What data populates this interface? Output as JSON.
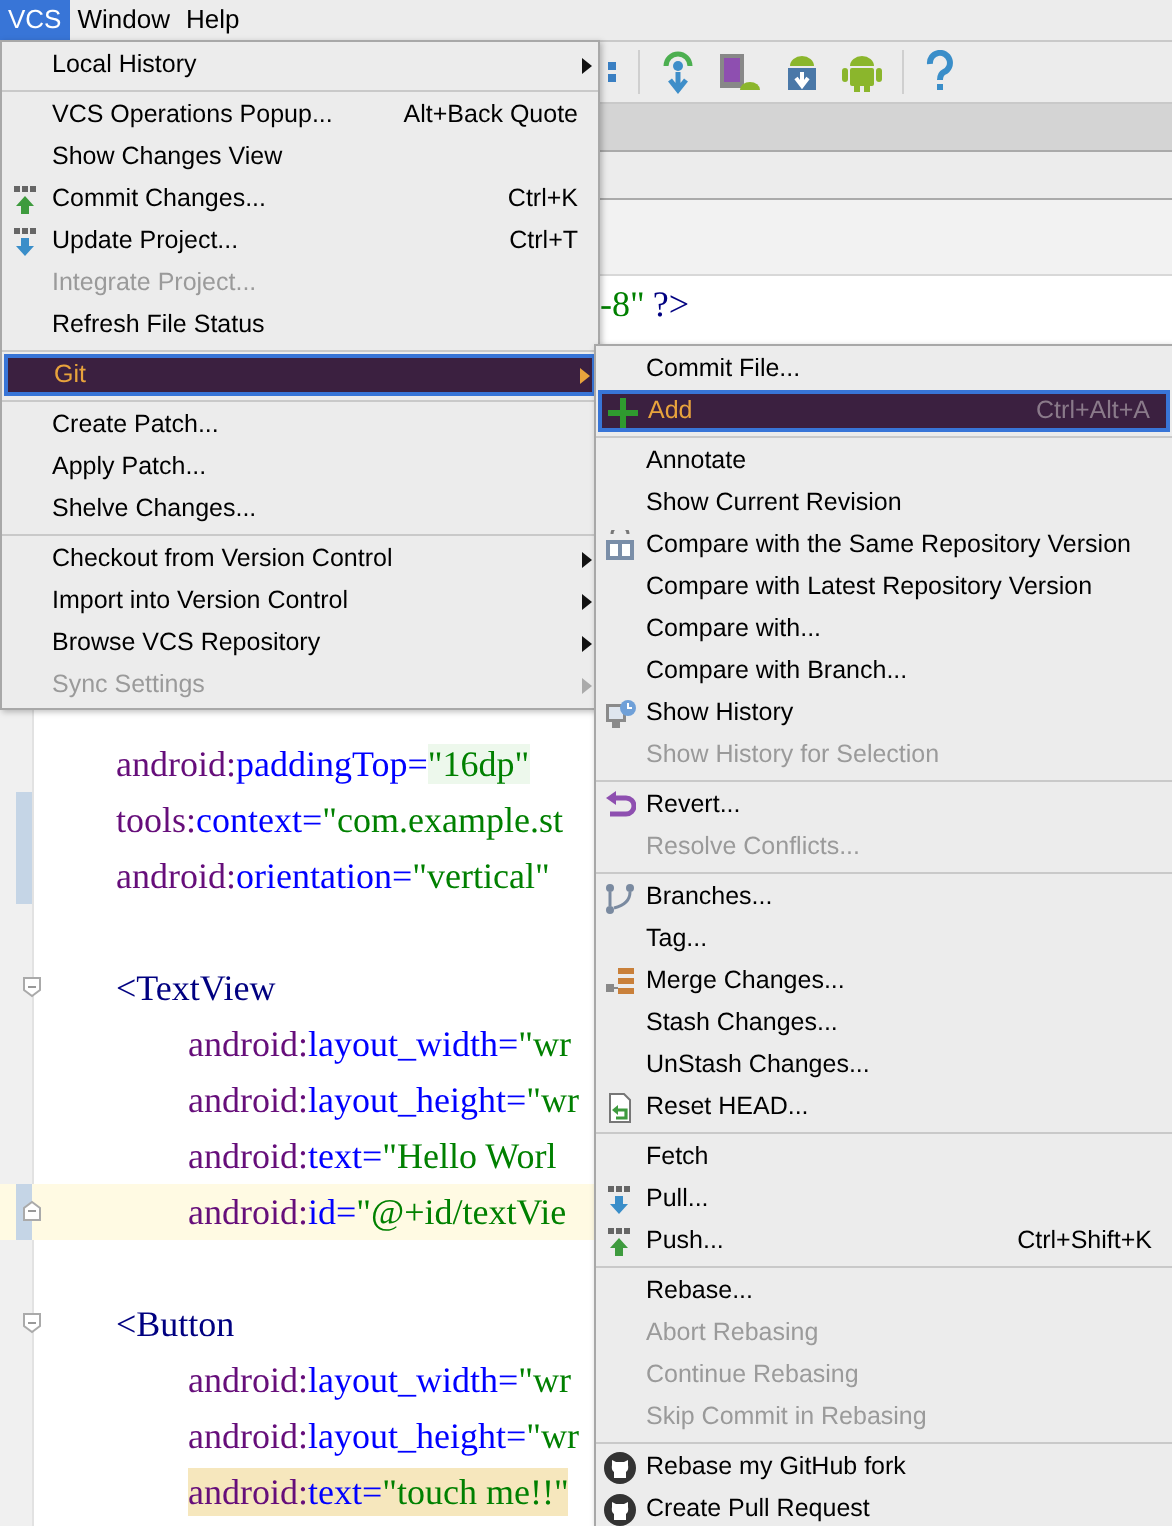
{
  "menubar": [
    {
      "label": "VCS",
      "selected": true
    },
    {
      "label": "Window",
      "selected": false
    },
    {
      "label": "Help",
      "selected": false
    }
  ],
  "editor": {
    "first_line": {
      "value": "-8\"",
      "tag": "?>"
    },
    "lines": [
      {
        "kind": "attr",
        "ns": "android:",
        "attr": "paddingTop=",
        "value": "\"16dp\"",
        "value_highlight": true,
        "changed": false,
        "caret_line": false,
        "highlighted": false
      },
      {
        "kind": "attr",
        "ns": "tools:",
        "attr": "context=",
        "value": "\"com.example.st",
        "value_highlight": false,
        "changed": true,
        "caret_line": false,
        "highlighted": false
      },
      {
        "kind": "attr",
        "ns": "android:",
        "attr": "orientation=",
        "value": "\"vertical\"",
        "value_highlight": false,
        "changed": true,
        "caret_line": false,
        "highlighted": false
      },
      {
        "kind": "blank"
      },
      {
        "kind": "tag",
        "tag": "<TextView",
        "children": [
          {
            "kind": "attr",
            "ns": "android:",
            "attr": "layout_width=",
            "value": "\"wr",
            "value_highlight": false,
            "changed": false,
            "caret_line": false,
            "highlighted": false,
            "fold_end": false
          },
          {
            "kind": "attr",
            "ns": "android:",
            "attr": "layout_height=",
            "value": "\"wr",
            "value_highlight": false,
            "changed": false,
            "caret_line": false,
            "highlighted": false,
            "fold_end": false
          },
          {
            "kind": "attr",
            "ns": "android:",
            "attr": "text=",
            "value": "\"Hello Worl",
            "value_highlight": false,
            "changed": false,
            "caret_line": false,
            "highlighted": false,
            "fold_end": false
          },
          {
            "kind": "attr",
            "ns": "android:",
            "attr": "id=",
            "value": "\"@+id/textVie",
            "value_highlight": false,
            "changed": true,
            "caret_line": true,
            "highlighted": false,
            "fold_end": true
          }
        ]
      },
      {
        "kind": "blank"
      },
      {
        "kind": "tag",
        "tag": "<Button",
        "children": [
          {
            "kind": "attr",
            "ns": "android:",
            "attr": "layout_width=",
            "value": "\"wr",
            "value_highlight": false,
            "changed": false,
            "caret_line": false,
            "highlighted": false,
            "fold_end": false
          },
          {
            "kind": "attr",
            "ns": "android:",
            "attr": "layout_height=",
            "value": "\"wr",
            "value_highlight": false,
            "changed": false,
            "caret_line": false,
            "highlighted": false,
            "fold_end": false
          },
          {
            "kind": "attr",
            "ns": "android:",
            "attr": "text=",
            "value": "\"touch me!!\"",
            "value_highlight": false,
            "changed": false,
            "caret_line": false,
            "highlighted": true,
            "fold_end": false
          }
        ]
      }
    ]
  },
  "vcs_menu": {
    "groups": [
      [
        {
          "label": "Local History",
          "submenu": true,
          "disabled": false,
          "selected": false
        }
      ],
      [
        {
          "label": "VCS Operations Popup...",
          "shortcut": "Alt+Back Quote",
          "disabled": false,
          "selected": false
        },
        {
          "label": "Show Changes View",
          "disabled": false,
          "selected": false
        },
        {
          "label": "Commit Changes...",
          "shortcut": "Ctrl+K",
          "disabled": false,
          "selected": false
        },
        {
          "label": "Update Project...",
          "shortcut": "Ctrl+T",
          "disabled": false,
          "selected": false
        },
        {
          "label": "Integrate Project...",
          "disabled": true,
          "selected": false
        },
        {
          "label": "Refresh File Status",
          "disabled": false,
          "selected": false
        }
      ],
      [
        {
          "label": "Git",
          "submenu": true,
          "disabled": false,
          "selected": true
        }
      ],
      [
        {
          "label": "Create Patch...",
          "disabled": false,
          "selected": false
        },
        {
          "label": "Apply Patch...",
          "disabled": false,
          "selected": false
        },
        {
          "label": "Shelve Changes...",
          "disabled": false,
          "selected": false
        }
      ],
      [
        {
          "label": "Checkout from Version Control",
          "submenu": true,
          "disabled": false,
          "selected": false
        },
        {
          "label": "Import into Version Control",
          "submenu": true,
          "disabled": false,
          "selected": false
        },
        {
          "label": "Browse VCS Repository",
          "submenu": true,
          "disabled": false,
          "selected": false
        },
        {
          "label": "Sync Settings",
          "submenu": true,
          "disabled": true,
          "selected": false
        }
      ]
    ]
  },
  "git_menu": {
    "groups": [
      [
        {
          "label": "Commit File...",
          "disabled": false,
          "selected": false
        },
        {
          "label": "Add",
          "shortcut": "Ctrl+Alt+A",
          "disabled": false,
          "selected": true
        }
      ],
      [
        {
          "label": "Annotate",
          "disabled": false,
          "selected": false
        },
        {
          "label": "Show Current Revision",
          "disabled": false,
          "selected": false
        },
        {
          "label": "Compare with the Same Repository Version",
          "disabled": false,
          "selected": false
        },
        {
          "label": "Compare with Latest Repository Version",
          "disabled": false,
          "selected": false
        },
        {
          "label": "Compare with...",
          "disabled": false,
          "selected": false
        },
        {
          "label": "Compare with Branch...",
          "disabled": false,
          "selected": false
        },
        {
          "label": "Show History",
          "disabled": false,
          "selected": false
        },
        {
          "label": "Show History for Selection",
          "disabled": true,
          "selected": false
        }
      ],
      [
        {
          "label": "Revert...",
          "disabled": false,
          "selected": false
        },
        {
          "label": "Resolve Conflicts...",
          "disabled": true,
          "selected": false
        }
      ],
      [
        {
          "label": "Branches...",
          "disabled": false,
          "selected": false
        },
        {
          "label": "Tag...",
          "disabled": false,
          "selected": false
        },
        {
          "label": "Merge Changes...",
          "disabled": false,
          "selected": false
        },
        {
          "label": "Stash Changes...",
          "disabled": false,
          "selected": false
        },
        {
          "label": "UnStash Changes...",
          "disabled": false,
          "selected": false
        },
        {
          "label": "Reset HEAD...",
          "disabled": false,
          "selected": false
        }
      ],
      [
        {
          "label": "Fetch",
          "disabled": false,
          "selected": false
        },
        {
          "label": "Pull...",
          "disabled": false,
          "selected": false
        },
        {
          "label": "Push...",
          "shortcut": "Ctrl+Shift+K",
          "disabled": false,
          "selected": false
        }
      ],
      [
        {
          "label": "Rebase...",
          "disabled": false,
          "selected": false
        },
        {
          "label": "Abort Rebasing",
          "disabled": true,
          "selected": false
        },
        {
          "label": "Continue Rebasing",
          "disabled": true,
          "selected": false
        },
        {
          "label": "Skip Commit in Rebasing",
          "disabled": true,
          "selected": false
        }
      ],
      [
        {
          "label": "Rebase my GitHub fork",
          "disabled": false,
          "selected": false
        },
        {
          "label": "Create Pull Request",
          "disabled": false,
          "selected": false
        }
      ]
    ]
  }
}
